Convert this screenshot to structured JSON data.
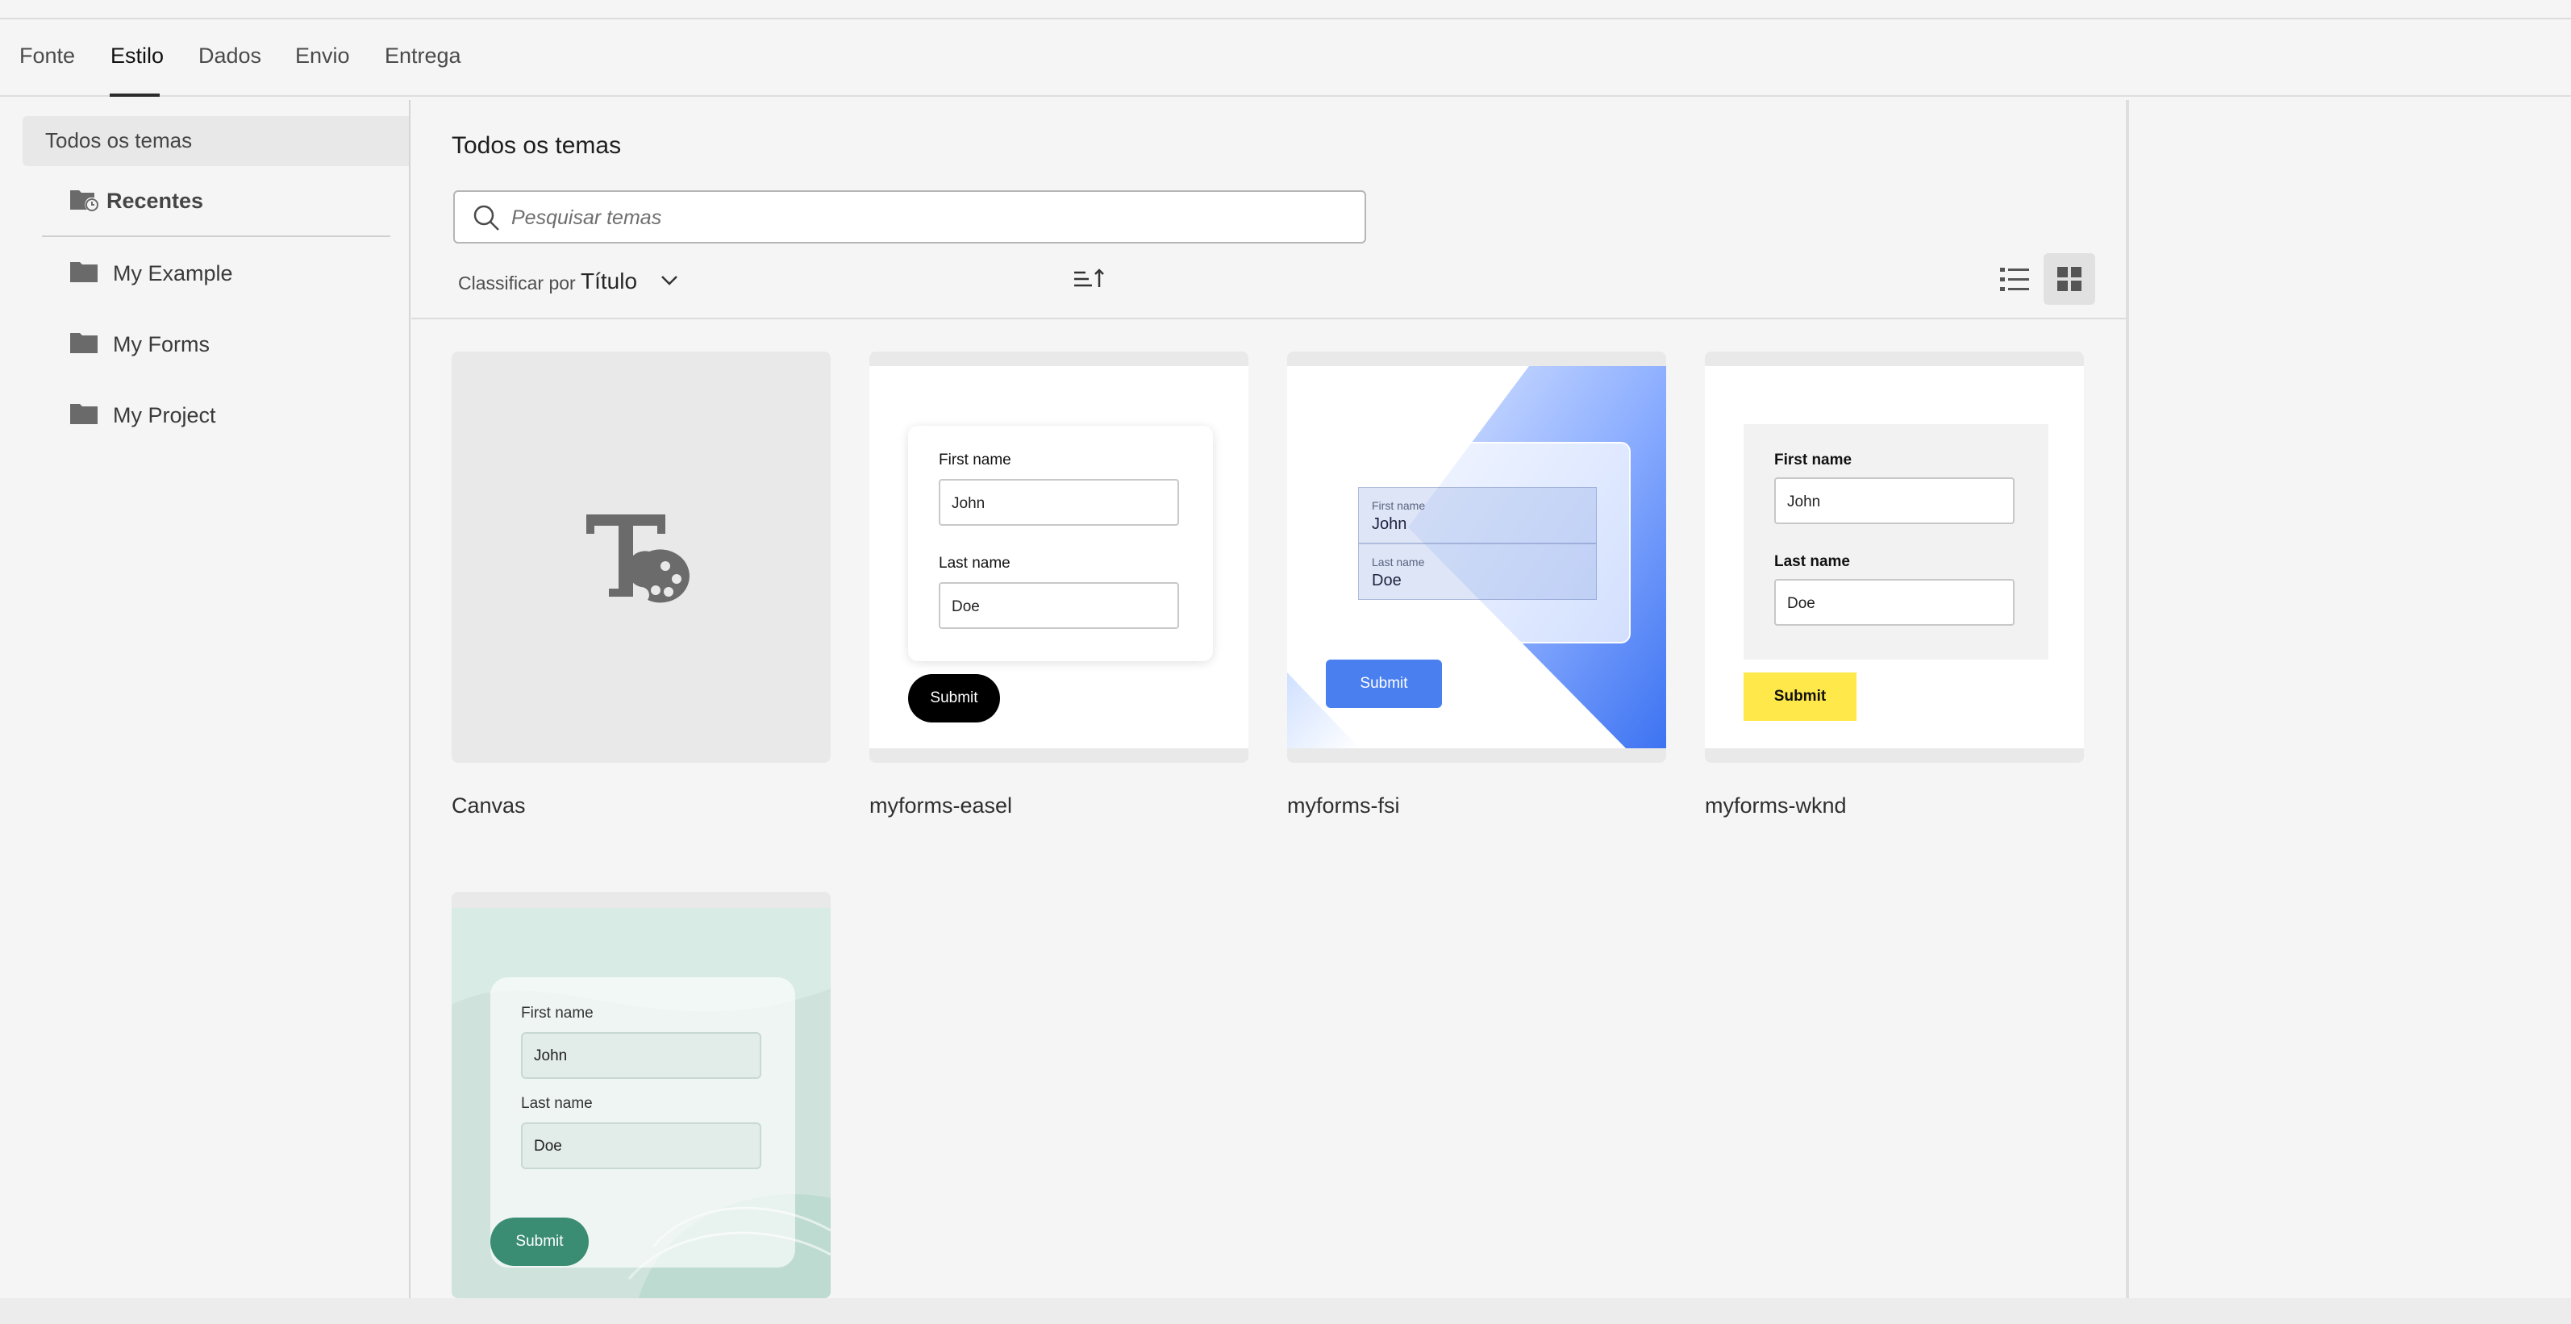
{
  "tabs": [
    {
      "label": "Fonte"
    },
    {
      "label": "Estilo"
    },
    {
      "label": "Dados"
    },
    {
      "label": "Envio"
    },
    {
      "label": "Entrega"
    }
  ],
  "active_tab": "Estilo",
  "sidebar": {
    "heading": "Todos os temas",
    "recent": "Recentes",
    "folders": [
      {
        "label": "My Example"
      },
      {
        "label": "My Forms"
      },
      {
        "label": "My Project"
      }
    ]
  },
  "main": {
    "title": "Todos os temas",
    "search_placeholder": "Pesquisar temas",
    "sort_label": "Classificar por",
    "sort_value": "Título"
  },
  "themes": [
    {
      "name": "Canvas"
    },
    {
      "name": "myforms-easel",
      "first_label": "First name",
      "first_value": "John",
      "last_label": "Last name",
      "last_value": "Doe",
      "button": "Submit"
    },
    {
      "name": "myforms-fsi",
      "first_label": "First name",
      "first_value": "John",
      "last_label": "Last name",
      "last_value": "Doe",
      "button": "Submit"
    },
    {
      "name": "myforms-wknd",
      "first_label": "First name",
      "first_value": "John",
      "last_label": "Last name",
      "last_value": "Doe",
      "button": "Submit"
    },
    {
      "name": "",
      "first_label": "First name",
      "first_value": "John",
      "last_label": "Last name",
      "last_value": "Doe",
      "button": "Submit"
    }
  ],
  "colors": {
    "easel_button": "#000000",
    "fsi_button": "#4a7ff0",
    "wknd_button": "#ffe84a",
    "teal_button": "#3a8d73"
  }
}
